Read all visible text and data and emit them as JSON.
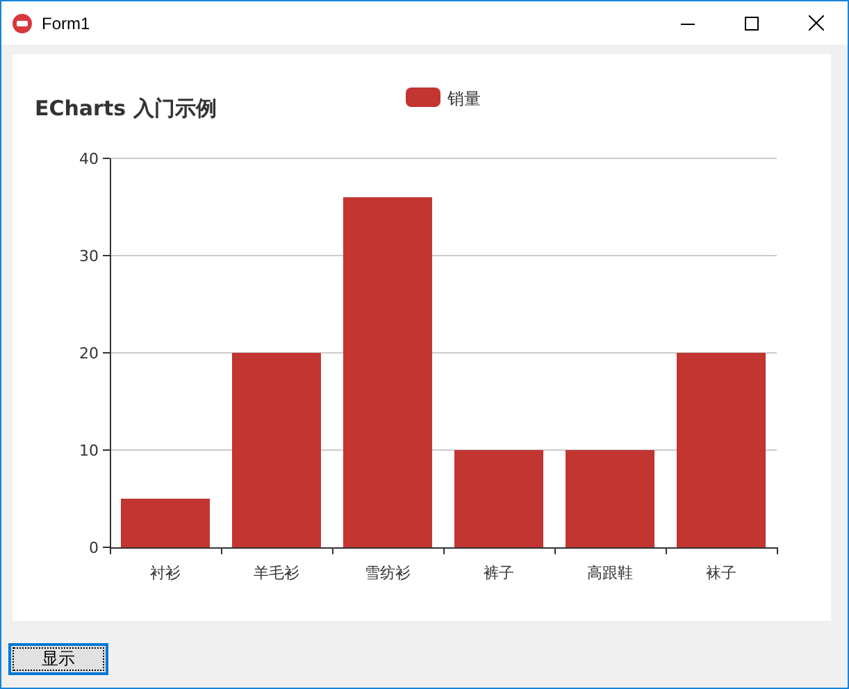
{
  "window": {
    "title": "Form1"
  },
  "chart": {
    "chart_data": {
      "type": "bar",
      "title": "ECharts 入门示例",
      "categories": [
        "衬衫",
        "羊毛衫",
        "雪纺衫",
        "裤子",
        "高跟鞋",
        "袜子"
      ],
      "series": [
        {
          "name": "销量",
          "color": "#c23531",
          "values": [
            5,
            20,
            36,
            10,
            10,
            20
          ]
        }
      ],
      "ylim": [
        0,
        40
      ],
      "grid": true,
      "yticks": [
        0,
        10,
        20,
        30,
        40
      ]
    }
  },
  "buttons": [
    {
      "label": "显示",
      "selected": true
    }
  ]
}
